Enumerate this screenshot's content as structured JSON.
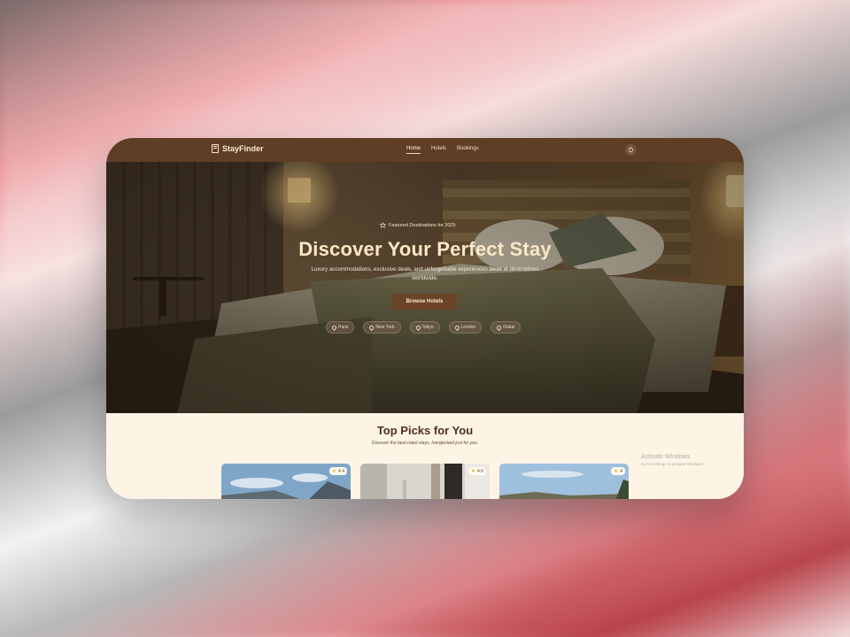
{
  "app": {
    "name": "StayFinder"
  },
  "nav": {
    "links": [
      "Home",
      "Hotels",
      "Bookings"
    ],
    "active": "Home"
  },
  "hero": {
    "badge": "Featured Destinations for 2025",
    "title": "Discover Your Perfect Stay",
    "subtitle": "Luxury accommodations, exclusive deals, and unforgettable experiences await at destinations worldwide.",
    "cta": "Browse Hotels",
    "destinations": [
      "Paris",
      "New York",
      "Tokyo",
      "London",
      "Dubai"
    ]
  },
  "picks": {
    "title": "Top Picks for You",
    "subtitle": "Discover the best-rated stays, handpicked just for you.",
    "cards": [
      {
        "rating": "4.4"
      },
      {
        "rating": "4.6"
      },
      {
        "rating": "4"
      }
    ]
  },
  "watermark": {
    "line1": "Activate Windows",
    "line2": "Go to Settings to activate Windows."
  },
  "colors": {
    "nav_bg": "#5e3e24",
    "accent": "#6b4428",
    "page_bg": "#fdf4e6",
    "title_brown": "#4e311c",
    "star": "#f2b728"
  },
  "icons": {
    "logo": "hotel-building-icon",
    "theme": "theme-toggle-icon",
    "badge": "star-outline-icon",
    "chip": "map-pin-icon",
    "rating": "star-filled-icon"
  }
}
